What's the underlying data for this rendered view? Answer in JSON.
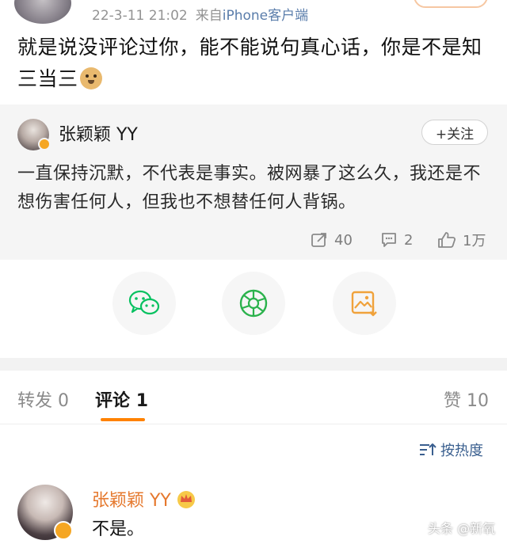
{
  "post": {
    "timestamp": "22-3-11 21:02",
    "source_prefix": "来自",
    "source_app": "iPhone客户端",
    "text": "就是说没评论过你，能不能说句真心话，你是不是知三当三"
  },
  "repost": {
    "author": "张颖颖 YY",
    "follow_label": "+关注",
    "text": "一直保持沉默，不代表是事实。被网暴了这么久，我还是不想伤害任何人，但我也不想替任何人背锅。",
    "stats": {
      "reposts": "40",
      "comments": "2",
      "likes": "1万"
    }
  },
  "tabs": {
    "repost_label": "转发",
    "repost_count": "0",
    "comment_label": "评论",
    "comment_count": "1",
    "like_label": "赞",
    "like_count": "10"
  },
  "sort": {
    "label": "按热度"
  },
  "comment": {
    "author": "张颖颖 YY",
    "text": "不是。"
  },
  "watermark": "头条 @新氧",
  "colors": {
    "accent": "#ff8200",
    "comment_author": "#e5782d",
    "link": "#5a7dab",
    "share_wechat": "#07c160",
    "share_moments": "#2bb24c",
    "share_image": "#f0a23b"
  },
  "icons": {
    "share": [
      "wechat-icon",
      "moments-icon",
      "save-image-icon"
    ],
    "stats": [
      "repost-icon",
      "comment-icon",
      "like-icon"
    ]
  }
}
